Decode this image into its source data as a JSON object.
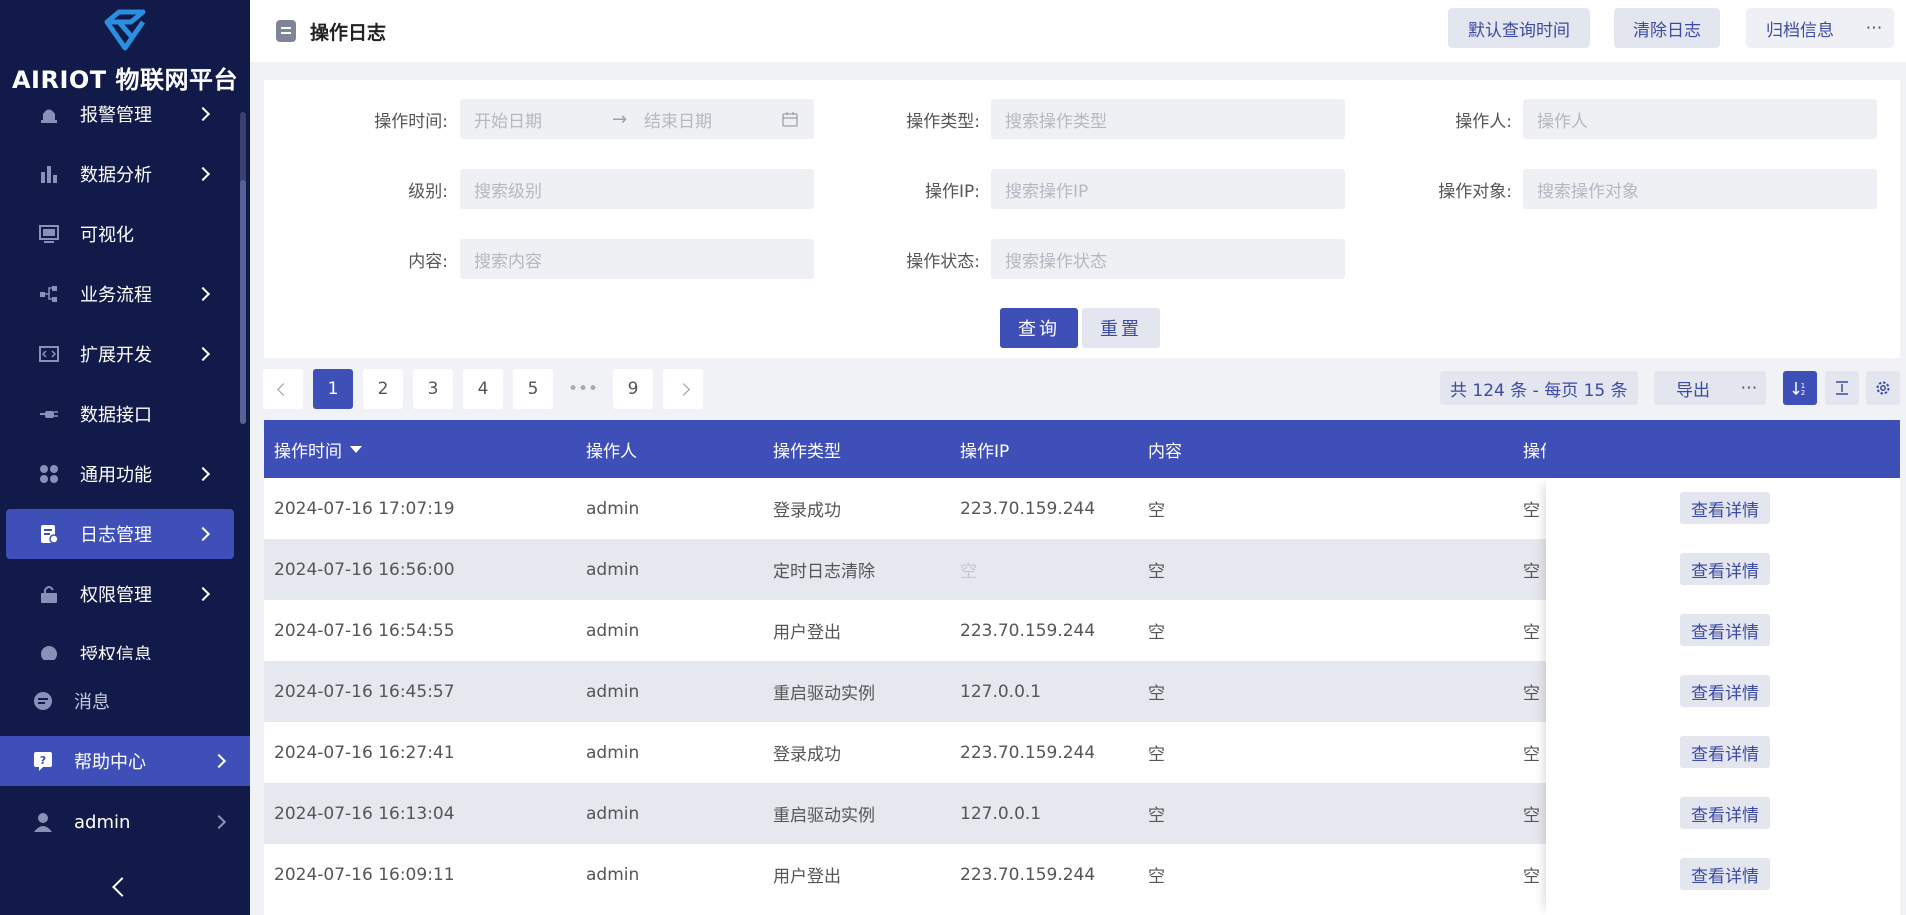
{
  "brand": "AIRIOT 物联网平台",
  "nav": [
    {
      "label": "报警管理",
      "icon": "alarm-icon",
      "chevron": true,
      "active": false
    },
    {
      "label": "数据分析",
      "icon": "bar-chart-icon",
      "chevron": true,
      "active": false
    },
    {
      "label": "可视化",
      "icon": "monitor-icon",
      "chevron": false,
      "active": false
    },
    {
      "label": "业务流程",
      "icon": "flow-icon",
      "chevron": true,
      "active": false
    },
    {
      "label": "扩展开发",
      "icon": "code-icon",
      "chevron": true,
      "active": false
    },
    {
      "label": "数据接口",
      "icon": "plug-icon",
      "chevron": false,
      "active": false
    },
    {
      "label": "通用功能",
      "icon": "grid-icon",
      "chevron": true,
      "active": false
    },
    {
      "label": "日志管理",
      "icon": "log-icon",
      "chevron": true,
      "active": true
    },
    {
      "label": "权限管理",
      "icon": "lock-icon",
      "chevron": true,
      "active": false
    },
    {
      "label": "授权信息",
      "icon": "license-icon",
      "chevron": false,
      "active": false
    }
  ],
  "bottom_nav": {
    "messages": "消息",
    "help": "帮助中心",
    "user": "admin"
  },
  "header": {
    "title": "操作日志",
    "default_time_btn": "默认查询时间",
    "clear_log_btn": "清除日志",
    "archive_btn": "归档信息",
    "more": "⋯"
  },
  "filters": {
    "op_time_label": "操作时间:",
    "start_date_placeholder": "开始日期",
    "end_date_placeholder": "结束日期",
    "op_type_label": "操作类型:",
    "op_type_placeholder": "搜索操作类型",
    "operator_label": "操作人:",
    "operator_placeholder": "操作人",
    "level_label": "级别:",
    "level_placeholder": "搜索级别",
    "op_ip_label": "操作IP:",
    "op_ip_placeholder": "搜索操作IP",
    "op_target_label": "操作对象:",
    "op_target_placeholder": "搜索操作对象",
    "content_label": "内容:",
    "content_placeholder": "搜索内容",
    "op_status_label": "操作状态:",
    "op_status_placeholder": "搜索操作状态",
    "query_btn": "查询",
    "reset_btn": "重置"
  },
  "pagination": {
    "pages": [
      "1",
      "2",
      "3",
      "4",
      "5"
    ],
    "ellipsis": "•••",
    "last_page": "9",
    "current": "1",
    "summary": "共 124 条 - 每页 15 条",
    "export_btn": "导出",
    "more": "⋯"
  },
  "table": {
    "columns": [
      "操作时间",
      "操作人",
      "操作类型",
      "操作IP",
      "内容",
      "操作"
    ],
    "detail_btn": "查看详情",
    "rows": [
      {
        "time": "2024-07-16 17:07:19",
        "user": "admin",
        "type": "登录成功",
        "ip": "223.70.159.244",
        "ip_empty": false,
        "content": "空",
        "target": "空"
      },
      {
        "time": "2024-07-16 16:56:00",
        "user": "admin",
        "type": "定时日志清除",
        "ip": "空",
        "ip_empty": true,
        "content": "空",
        "target": "空"
      },
      {
        "time": "2024-07-16 16:54:55",
        "user": "admin",
        "type": "用户登出",
        "ip": "223.70.159.244",
        "ip_empty": false,
        "content": "空",
        "target": "空"
      },
      {
        "time": "2024-07-16 16:45:57",
        "user": "admin",
        "type": "重启驱动实例",
        "ip": "127.0.0.1",
        "ip_empty": false,
        "content": "空",
        "target": "空"
      },
      {
        "time": "2024-07-16 16:27:41",
        "user": "admin",
        "type": "登录成功",
        "ip": "223.70.159.244",
        "ip_empty": false,
        "content": "空",
        "target": "空"
      },
      {
        "time": "2024-07-16 16:13:04",
        "user": "admin",
        "type": "重启驱动实例",
        "ip": "127.0.0.1",
        "ip_empty": false,
        "content": "空",
        "target": "空"
      },
      {
        "time": "2024-07-16 16:09:11",
        "user": "admin",
        "type": "用户登出",
        "ip": "223.70.159.244",
        "ip_empty": false,
        "content": "空",
        "target": "空"
      }
    ]
  },
  "colors": {
    "sidebar_bg": "#121a4a",
    "primary": "#3f4fb8",
    "light_btn": "#e3e6ee"
  }
}
